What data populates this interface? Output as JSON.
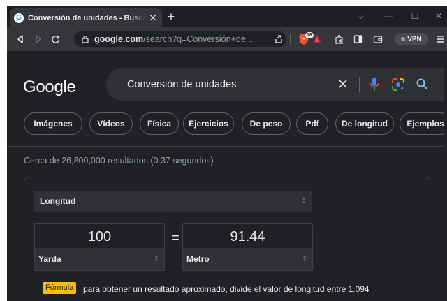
{
  "browser": {
    "tab": {
      "title": "Conversión de unidades - Buscar con Google",
      "favicon": "G"
    },
    "url": {
      "host": "google.com",
      "path": "/search?q=Conversión+de..."
    },
    "shields_count": "18",
    "vpn_label": "VPN"
  },
  "google": {
    "logo": "Google",
    "query": "Conversión de unidades"
  },
  "chips": [
    "Imágenes",
    "Vídeos",
    "Física",
    "Ejercicios",
    "De peso",
    "Pdf",
    "De longitud",
    "Ejemplos"
  ],
  "results_stats": "Cerca de 26,800,000 resultados (0.37 segundos)",
  "converter": {
    "unit_type": "Longitud",
    "from": {
      "value": "100",
      "unit": "Yarda"
    },
    "equals": "=",
    "to": {
      "value": "91.44",
      "unit": "Metro"
    },
    "formula_label": "Fórmula",
    "formula_text": "para obtener un resultado aproximado, divide el valor de longitud entre 1.094"
  },
  "colors": {
    "background": "#202124",
    "toolbar": "#35363a",
    "searchbox": "#303134",
    "formula_badge": "#fbbc04",
    "brave_orange": "#fb542b",
    "mic_blue": "#4285f4"
  }
}
